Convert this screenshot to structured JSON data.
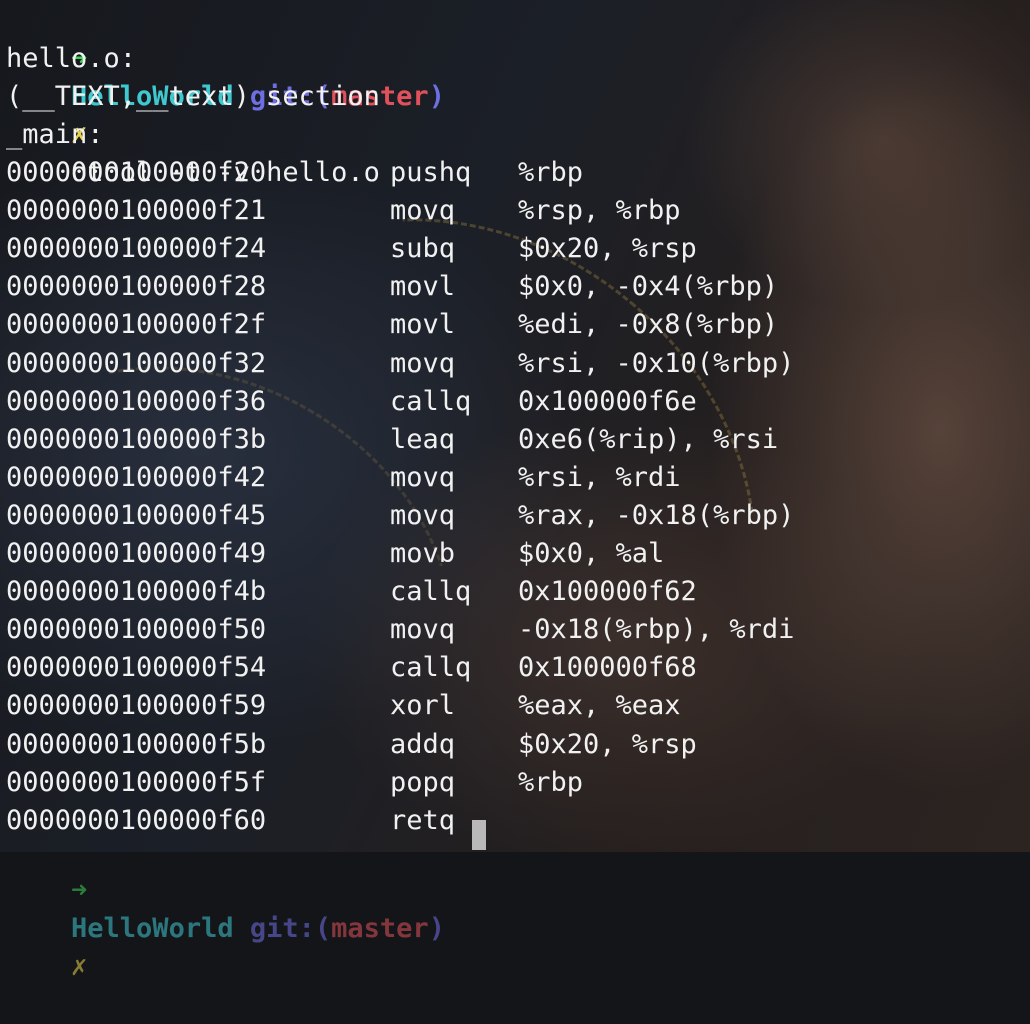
{
  "prompt": {
    "arrow": "➜",
    "directory": "HelloWorld",
    "git_label": "git:(",
    "branch": "master",
    "git_close": ")",
    "dirty_marker": "✗",
    "command": "otool -t -v hello.o"
  },
  "output": {
    "file": "hello.o:",
    "section": "(__TEXT,__text) section",
    "symbol": "_main:",
    "rows": [
      {
        "addr": "0000000100000f20",
        "op": "pushq",
        "args": "%rbp"
      },
      {
        "addr": "0000000100000f21",
        "op": "movq",
        "args": "%rsp, %rbp"
      },
      {
        "addr": "0000000100000f24",
        "op": "subq",
        "args": "$0x20, %rsp"
      },
      {
        "addr": "0000000100000f28",
        "op": "movl",
        "args": "$0x0, -0x4(%rbp)"
      },
      {
        "addr": "0000000100000f2f",
        "op": "movl",
        "args": "%edi, -0x8(%rbp)"
      },
      {
        "addr": "0000000100000f32",
        "op": "movq",
        "args": "%rsi, -0x10(%rbp)"
      },
      {
        "addr": "0000000100000f36",
        "op": "callq",
        "args": "0x100000f6e"
      },
      {
        "addr": "0000000100000f3b",
        "op": "leaq",
        "args": "0xe6(%rip), %rsi"
      },
      {
        "addr": "0000000100000f42",
        "op": "movq",
        "args": "%rsi, %rdi"
      },
      {
        "addr": "0000000100000f45",
        "op": "movq",
        "args": "%rax, -0x18(%rbp)"
      },
      {
        "addr": "0000000100000f49",
        "op": "movb",
        "args": "$0x0, %al"
      },
      {
        "addr": "0000000100000f4b",
        "op": "callq",
        "args": "0x100000f62"
      },
      {
        "addr": "0000000100000f50",
        "op": "movq",
        "args": "-0x18(%rbp), %rdi"
      },
      {
        "addr": "0000000100000f54",
        "op": "callq",
        "args": "0x100000f68"
      },
      {
        "addr": "0000000100000f59",
        "op": "xorl",
        "args": "%eax, %eax"
      },
      {
        "addr": "0000000100000f5b",
        "op": "addq",
        "args": "$0x20, %rsp"
      },
      {
        "addr": "0000000100000f5f",
        "op": "popq",
        "args": "%rbp"
      },
      {
        "addr": "0000000100000f60",
        "op": "retq",
        "args": ""
      }
    ]
  },
  "colors": {
    "arrow": "#3ecf55",
    "directory": "#40c8cf",
    "git_label": "#6f6fe4",
    "branch": "#e0515b",
    "dirty": "#e5d24b",
    "text": "#f1f1f1"
  },
  "icons": {
    "cursor": "block-cursor-icon"
  }
}
